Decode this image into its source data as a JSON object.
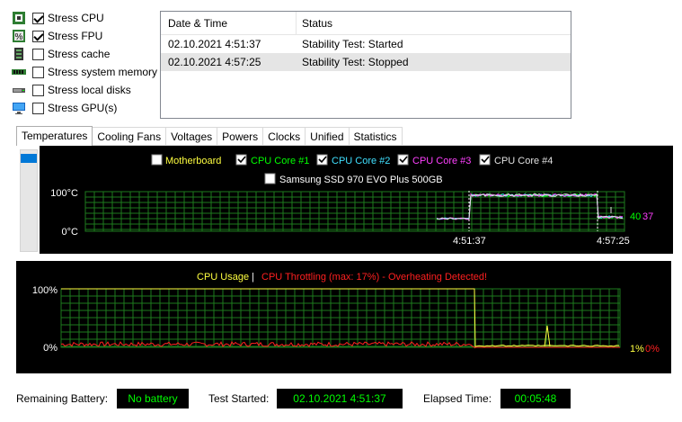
{
  "stress_options": [
    {
      "label": "Stress CPU",
      "checked": true,
      "icon": "cpu-icon"
    },
    {
      "label": "Stress FPU",
      "checked": true,
      "icon": "fpu-icon"
    },
    {
      "label": "Stress cache",
      "checked": false,
      "icon": "cache-icon"
    },
    {
      "label": "Stress system memory",
      "checked": false,
      "icon": "memory-icon"
    },
    {
      "label": "Stress local disks",
      "checked": false,
      "icon": "disk-icon"
    },
    {
      "label": "Stress GPU(s)",
      "checked": false,
      "icon": "gpu-icon"
    }
  ],
  "log": {
    "headers": [
      "Date & Time",
      "Status"
    ],
    "rows": [
      {
        "time": "02.10.2021 4:51:37",
        "status": "Stability Test: Started"
      },
      {
        "time": "02.10.2021 4:57:25",
        "status": "Stability Test: Stopped"
      }
    ]
  },
  "tabs": [
    "Temperatures",
    "Cooling Fans",
    "Voltages",
    "Powers",
    "Clocks",
    "Unified",
    "Statistics"
  ],
  "active_tab": "Temperatures",
  "temp_legend": [
    {
      "label": "Motherboard",
      "checked": false,
      "color": "#ffff40"
    },
    {
      "label": "CPU Core #1",
      "checked": true,
      "color": "#00ff00"
    },
    {
      "label": "CPU Core #2",
      "checked": true,
      "color": "#40e0ff"
    },
    {
      "label": "CPU Core #3",
      "checked": true,
      "color": "#ff40ff"
    },
    {
      "label": "CPU Core #4",
      "checked": true,
      "color": "#e0e0e0"
    },
    {
      "label": "Samsung SSD 970 EVO Plus 500GB",
      "checked": false,
      "color": "#ffffff"
    }
  ],
  "temp_chart": {
    "y_max_label": "100°C",
    "y_min_label": "0°C",
    "x_labels": [
      "4:51:37",
      "4:57:25"
    ],
    "current_values": [
      "40",
      "37"
    ],
    "current_colors": [
      "#00ff00",
      "#ff40ff"
    ]
  },
  "usage_chart": {
    "title_usage": "CPU Usage",
    "title_sep": "|",
    "title_throttle": "CPU Throttling (max: 17%) - Overheating Detected!",
    "y_max_label": "100%",
    "y_min_label": "0%",
    "current_usage": "1%",
    "current_throttle": "0%",
    "usage_color": "#ffff40",
    "throttle_color": "#ff2020"
  },
  "status": {
    "battery_label": "Remaining Battery:",
    "battery_value": "No battery",
    "started_label": "Test Started:",
    "started_value": "02.10.2021 4:51:37",
    "elapsed_label": "Elapsed Time:",
    "elapsed_value": "00:05:48"
  }
}
